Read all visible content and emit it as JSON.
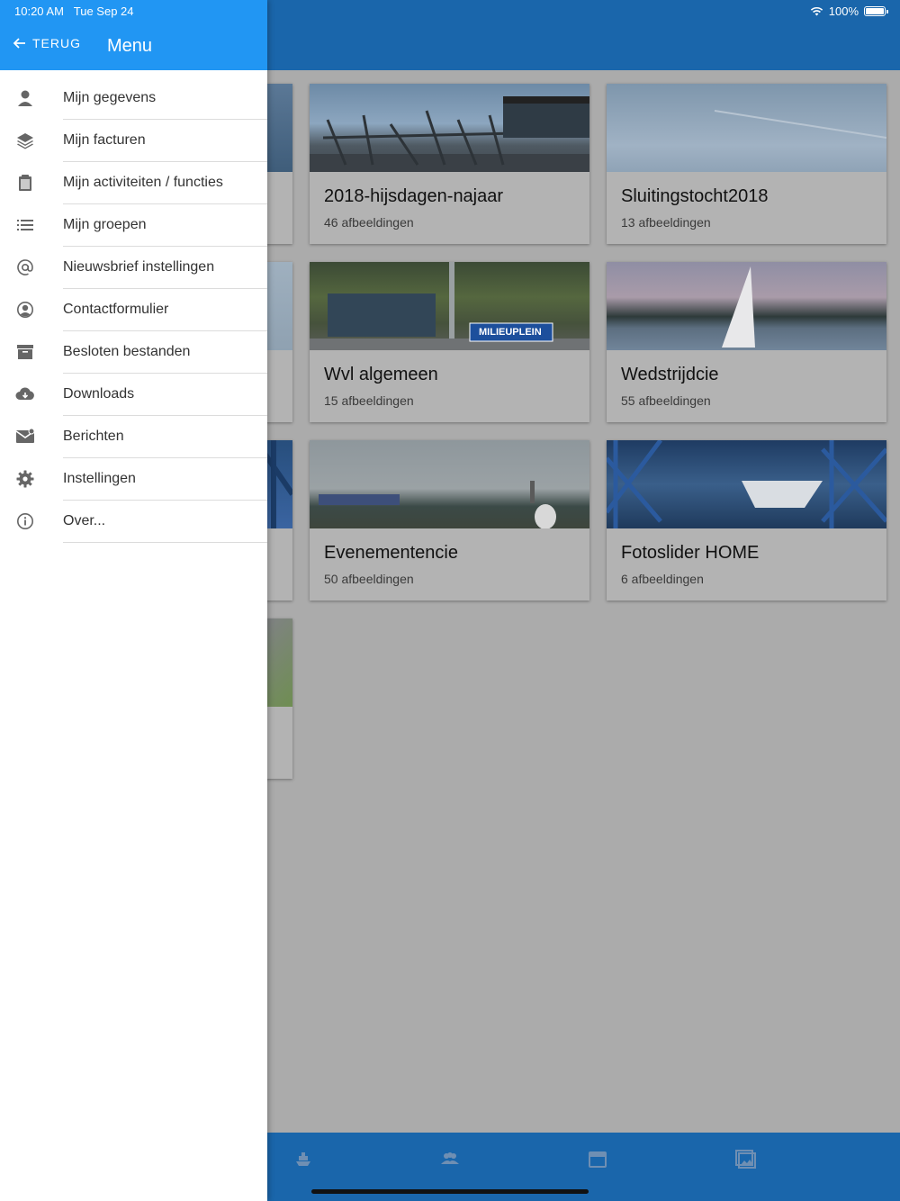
{
  "status": {
    "time": "10:20 AM",
    "date": "Tue Sep 24",
    "battery": "100%"
  },
  "drawer": {
    "back_label": "TERUG",
    "title": "Menu",
    "items": [
      {
        "label": "Mijn gegevens",
        "icon": "person-icon"
      },
      {
        "label": "Mijn facturen",
        "icon": "layers-icon"
      },
      {
        "label": "Mijn activiteiten / functies",
        "icon": "clipboard-icon"
      },
      {
        "label": "Mijn groepen",
        "icon": "list-icon"
      },
      {
        "label": "Nieuwsbrief instellingen",
        "icon": "at-icon"
      },
      {
        "label": "Contactformulier",
        "icon": "account-circle-icon"
      },
      {
        "label": "Besloten bestanden",
        "icon": "archive-icon"
      },
      {
        "label": "Downloads",
        "icon": "cloud-download-icon"
      },
      {
        "label": "Berichten",
        "icon": "mail-icon"
      },
      {
        "label": "Instellingen",
        "icon": "gear-icon"
      },
      {
        "label": "Over...",
        "icon": "info-icon"
      }
    ]
  },
  "albums": [
    {
      "title": "2018-hijsdagen-najaar",
      "count": "46 afbeeldingen"
    },
    {
      "title": "Sluitingstocht2018",
      "count": "13 afbeeldingen"
    },
    {
      "title": "Wvl algemeen",
      "count": "15 afbeeldingen"
    },
    {
      "title": "Wedstrijdcie",
      "count": "55 afbeeldingen"
    },
    {
      "title": "Evenementencie",
      "count": "50 afbeeldingen"
    },
    {
      "title": "Fotoslider HOME",
      "count": "6 afbeeldingen"
    }
  ],
  "photo_text": {
    "sign": "MILIEUPLEIN"
  },
  "tabbar": {
    "tabs": [
      "boat-icon",
      "group-icon",
      "calendar-icon",
      "photos-icon"
    ]
  },
  "colors": {
    "header": "#2196f3",
    "app_bar": "#1a66ab",
    "overlay_bg": "#ababab"
  }
}
